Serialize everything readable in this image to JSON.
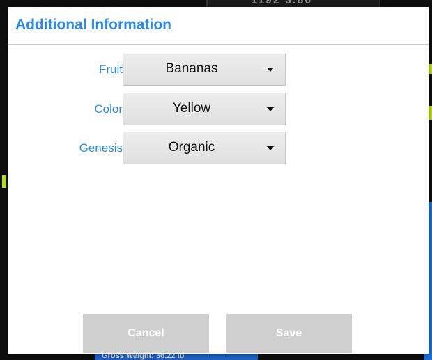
{
  "dialog": {
    "title": "Additional Information",
    "fields": [
      {
        "label": "Fruit",
        "value": "Bananas"
      },
      {
        "label": "Color",
        "value": "Yellow"
      },
      {
        "label": "Genesis",
        "value": "Organic"
      }
    ],
    "buttons": {
      "cancel_label": "Cancel",
      "save_label": "Save"
    }
  },
  "background": {
    "top_text": "1192 3.80",
    "bottom_text": "Gross Weight:   36.22          lb"
  },
  "colors": {
    "accent": "#2b8be6",
    "button_disabled": "#cfcfcf",
    "select_bg": "#e6e6e6",
    "bg_green": "#b6e11a",
    "bg_blue": "#1f6fd0"
  },
  "icons": {
    "dropdown": "chevron-down-icon"
  }
}
